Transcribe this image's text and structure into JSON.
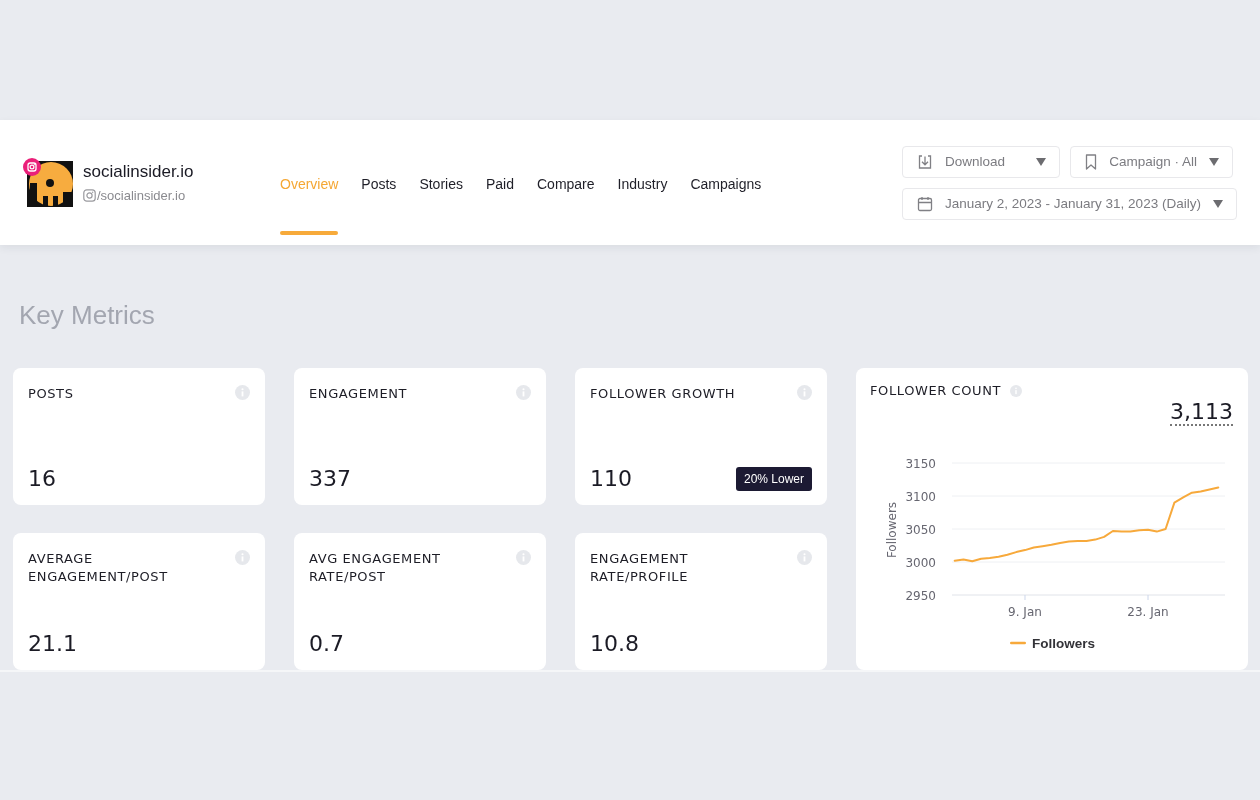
{
  "profile": {
    "name": "socialinsider.io",
    "handle": "/socialinsider.io"
  },
  "tabs": [
    {
      "label": "Overview",
      "selected": true
    },
    {
      "label": "Posts",
      "selected": false
    },
    {
      "label": "Stories",
      "selected": false
    },
    {
      "label": "Paid",
      "selected": false
    },
    {
      "label": "Compare",
      "selected": false
    },
    {
      "label": "Industry",
      "selected": false
    },
    {
      "label": "Campaigns",
      "selected": false
    }
  ],
  "controls": [
    {
      "kind": "download",
      "label": "Download"
    },
    {
      "kind": "campaign",
      "label": "Campaign · All"
    },
    {
      "kind": "date",
      "label": "January 2, 2023 - January 31, 2023 (Daily)"
    }
  ],
  "section_title": "Key Metrics",
  "metrics": [
    {
      "title": "POSTS",
      "value": "16"
    },
    {
      "title": "ENGAGEMENT",
      "value": "337"
    },
    {
      "title": "FOLLOWER GROWTH",
      "value": "110",
      "badge": "20% Lower"
    },
    {
      "title": "AVERAGE\nENGAGEMENT/POST",
      "value": "21.1"
    },
    {
      "title": "AVG ENGAGEMENT\nRATE/POST",
      "value": "0.7"
    },
    {
      "title": "ENGAGEMENT\nRATE/PROFILE",
      "value": "10.8"
    }
  ],
  "follower_count": {
    "title": "FOLLOWER COUNT",
    "total": "3,113",
    "chart_data": {
      "type": "line",
      "ylabel": "Followers",
      "categories": [
        null,
        null,
        null,
        null,
        null,
        null,
        null,
        null,
        "9. Jan",
        null,
        null,
        null,
        null,
        null,
        null,
        null,
        null,
        null,
        null,
        null,
        null,
        null,
        "23. Jan",
        null,
        null,
        null,
        null,
        null,
        null,
        null,
        null
      ],
      "series": [
        {
          "name": "Followers",
          "color": "#f7a93b",
          "values": [
            3002,
            3004,
            3001,
            3005,
            3006,
            3008,
            3011,
            3015,
            3018,
            3022,
            3024,
            3026,
            3029,
            3031,
            3032,
            3032,
            3034,
            3038,
            3047,
            3046,
            3046,
            3048,
            3049,
            3046,
            3050,
            3090,
            3098,
            3105,
            3107,
            3110,
            3113
          ]
        }
      ],
      "ylim": [
        2950,
        3150
      ],
      "yticks": [
        {
          "value": 2950,
          "label": "2950"
        },
        {
          "value": 3000,
          "label": "3000"
        },
        {
          "value": 3050,
          "label": "3050"
        },
        {
          "value": 3100,
          "label": "3100"
        },
        {
          "value": 3150,
          "label": "3150"
        }
      ],
      "grid": true
    }
  }
}
